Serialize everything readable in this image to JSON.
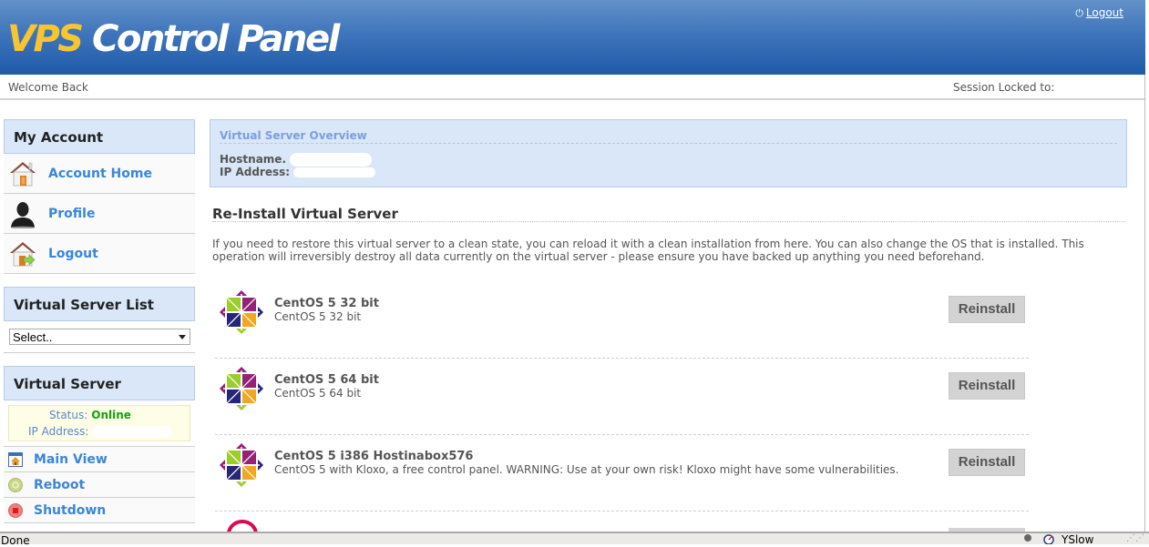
{
  "header": {
    "logo_part1": "VPS",
    "logo_part2": "Control Panel",
    "logout_label": "Logout",
    "welcome": "Welcome Back",
    "session_locked": "Session Locked to:"
  },
  "sidebar": {
    "my_account": {
      "title": "My Account",
      "items": [
        {
          "label": "Account Home",
          "icon": "house-icon"
        },
        {
          "label": "Profile",
          "icon": "user-icon"
        },
        {
          "label": "Logout",
          "icon": "house-exit-icon"
        }
      ]
    },
    "server_list": {
      "title": "Virtual Server List",
      "select_value": "Select.."
    },
    "virtual_server": {
      "title": "Virtual Server",
      "status_label": "Status:",
      "status_value": "Online",
      "ip_label": "IP Address:",
      "items": [
        {
          "label": "Main View",
          "icon": "main-view-icon"
        },
        {
          "label": "Reboot",
          "icon": "reboot-icon"
        },
        {
          "label": "Shutdown",
          "icon": "shutdown-icon"
        }
      ]
    }
  },
  "main": {
    "overview": {
      "title": "Virtual Server Overview",
      "hostname_label": "Hostname.",
      "ip_label": "IP Address:"
    },
    "reinstall": {
      "title": "Re-Install Virtual Server",
      "description": "If you need to restore this virtual server to a clean state, you can reload it with a clean installation from here. You can also change the OS that is installed. This operation will irreversibly destroy all data currently on the virtual server - please ensure you have backed up anything you need beforehand.",
      "button_label": "Reinstall",
      "os_list": [
        {
          "name": "CentOS 5 32 bit",
          "description": "CentOS 5 32 bit"
        },
        {
          "name": "CentOS 5 64 bit",
          "description": "CentOS 5 64 bit"
        },
        {
          "name": "CentOS 5 i386 Hostinabox576",
          "description": "CentOS 5 with Kloxo, a free control panel. WARNING: Use at your own risk! Kloxo might have some vulnerabilities."
        }
      ]
    }
  },
  "statusbar": {
    "status": "Done",
    "addon": "YSlow"
  },
  "colors": {
    "header_blue": "#1f5aa8",
    "logo_yellow": "#f7c531",
    "link_blue": "#3a86d8",
    "panel_blue": "#d9e7f8",
    "online_green": "#13a10e"
  }
}
